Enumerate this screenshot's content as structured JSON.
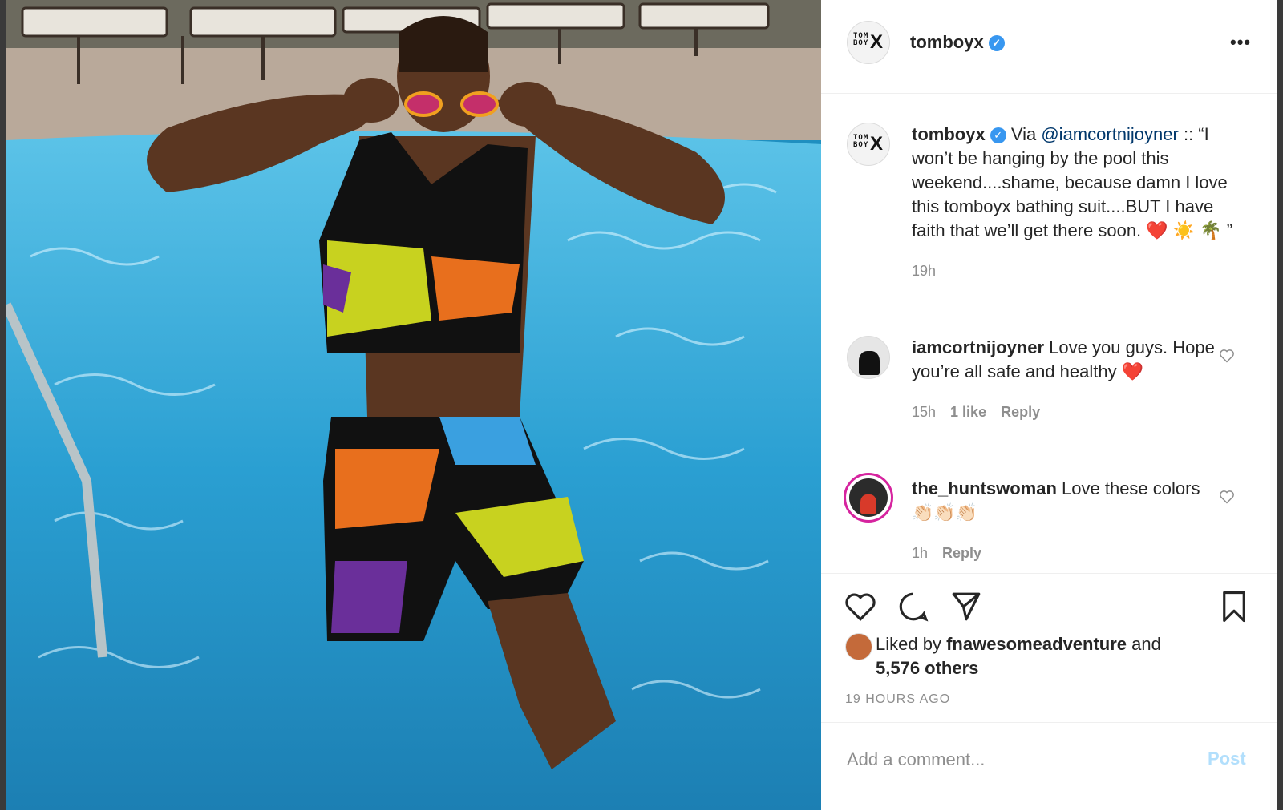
{
  "post": {
    "username": "tomboyx",
    "more_label": "•••",
    "avatar_text": "TOM\nBOY",
    "avatar_x": "X"
  },
  "caption": {
    "username": "tomboyx",
    "pre_mention": "Via",
    "mention": "@iamcortnijoyner",
    "text": ":: “I won’t be hanging by the pool this weekend....shame, because damn I love this tomboyx bathing suit....BUT I have faith that we’ll get there soon. ❤️ ☀️ 🌴 ”",
    "time": "19h"
  },
  "comments": [
    {
      "username": "iamcortnijoyner",
      "text": "Love you guys. Hope you’re all safe and healthy ❤️",
      "time": "15h",
      "likes": "1 like",
      "reply": "Reply"
    },
    {
      "username": "the_huntswoman",
      "text": "Love these colors 👏🏻👏🏻👏🏻",
      "time": "1h",
      "reply": "Reply"
    }
  ],
  "likes": {
    "prefix": "Liked by",
    "user": "fnawesomeadventure",
    "and": "and",
    "others": "5,576 others"
  },
  "timestamp": "19 HOURS AGO",
  "add_comment": {
    "placeholder": "Add a comment...",
    "post_label": "Post"
  },
  "colors": {
    "accent": "#3897f0",
    "mention": "#00376b",
    "muted": "#8e8e8e",
    "post_disabled": "#b2dffc"
  },
  "icons": [
    "heart-icon",
    "comment-icon",
    "share-icon",
    "bookmark-icon",
    "verified-badge-icon",
    "more-icon"
  ]
}
